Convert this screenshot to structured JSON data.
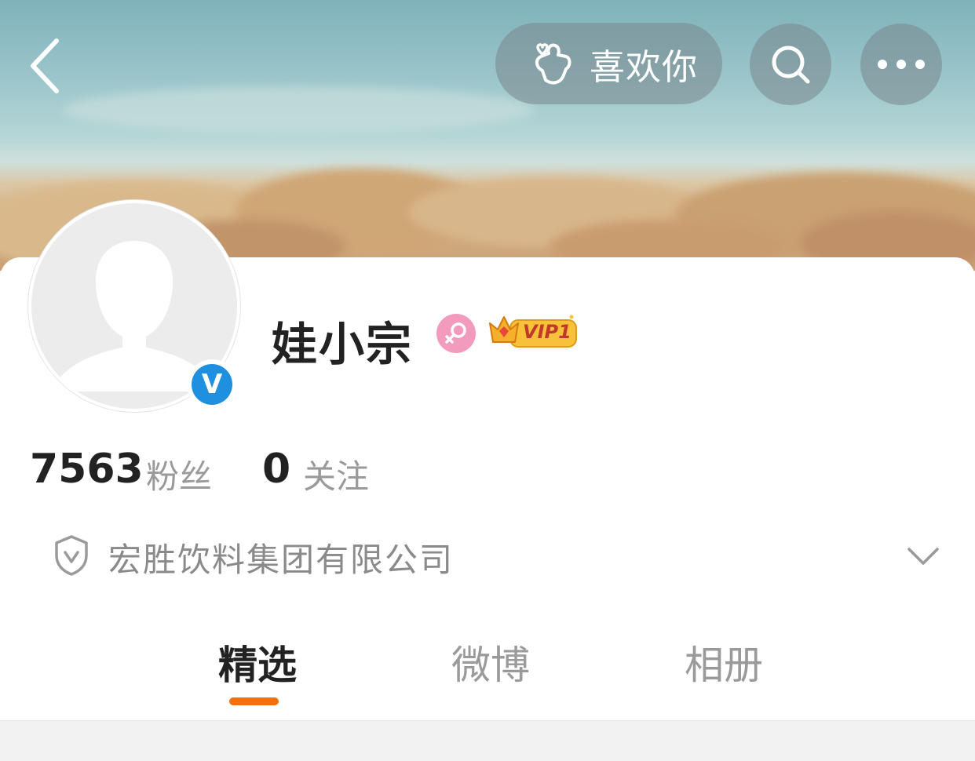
{
  "header": {
    "like_label": "喜欢你",
    "icons": {
      "back": "back-arrow-icon",
      "like": "finger-heart-icon",
      "search": "search-icon",
      "more": "more-dots-icon"
    }
  },
  "profile": {
    "username": "娃小宗",
    "gender": "female",
    "vip_label": "VIP1",
    "verified": true,
    "verify_mark": "V"
  },
  "stats": {
    "fans_count": "7563",
    "fans_label": "粉丝",
    "following_count": "0",
    "following_label": "关注"
  },
  "company": {
    "name": "宏胜饮料集团有限公司"
  },
  "tabs": [
    {
      "label": "精选",
      "active": true
    },
    {
      "label": "微博",
      "active": false
    },
    {
      "label": "相册",
      "active": false
    }
  ],
  "colors": {
    "accent": "#f0700f",
    "verify_blue": "#1f8fe0",
    "female_pink": "#f29bbd",
    "vip_gold": "#f7c23a"
  }
}
